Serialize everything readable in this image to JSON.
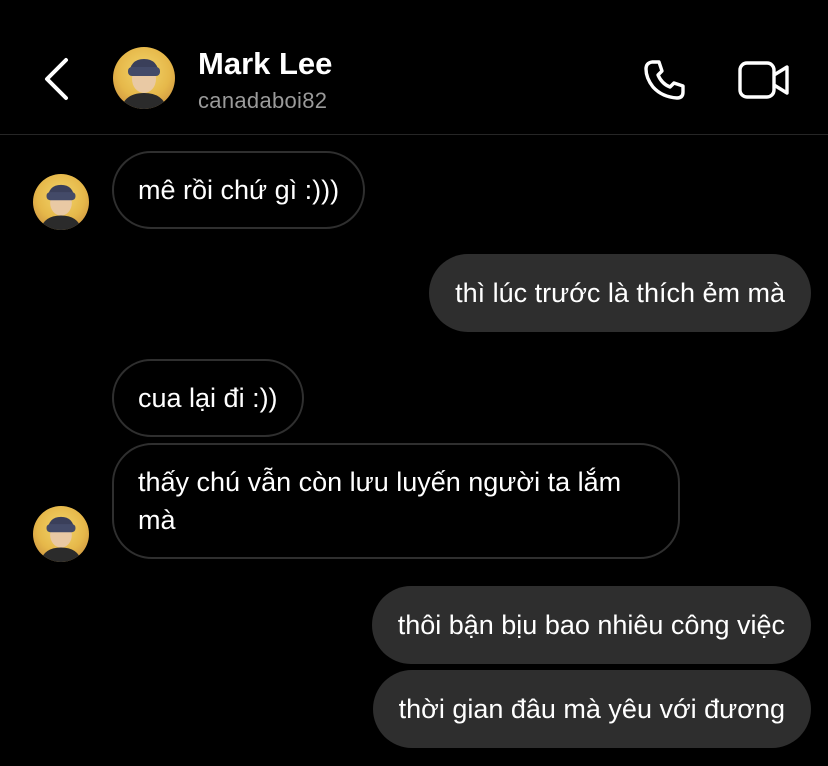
{
  "header": {
    "name": "Mark Lee",
    "username": "canadaboi82"
  },
  "icons": {
    "back": "chevron-left-icon",
    "call": "phone-icon",
    "video": "video-camera-icon"
  },
  "messages": [
    {
      "sender": "them",
      "text": "mê rồi chứ gì :)))"
    },
    {
      "sender": "me",
      "text": "thì lúc trước là thích ẻm mà"
    },
    {
      "sender": "them",
      "text": "cua lại đi :))"
    },
    {
      "sender": "them",
      "text": "thấy chú vẫn còn lưu luyến người ta lắm mà"
    },
    {
      "sender": "me",
      "text": "thôi bận bịu bao nhiêu công việc"
    },
    {
      "sender": "me",
      "text": "thời gian đâu mà yêu với đương"
    }
  ],
  "colors": {
    "background": "#000000",
    "outgoing_bubble": "#2e2e2e",
    "incoming_border": "#2f2f2f",
    "secondary_text": "#9a9a9a"
  }
}
